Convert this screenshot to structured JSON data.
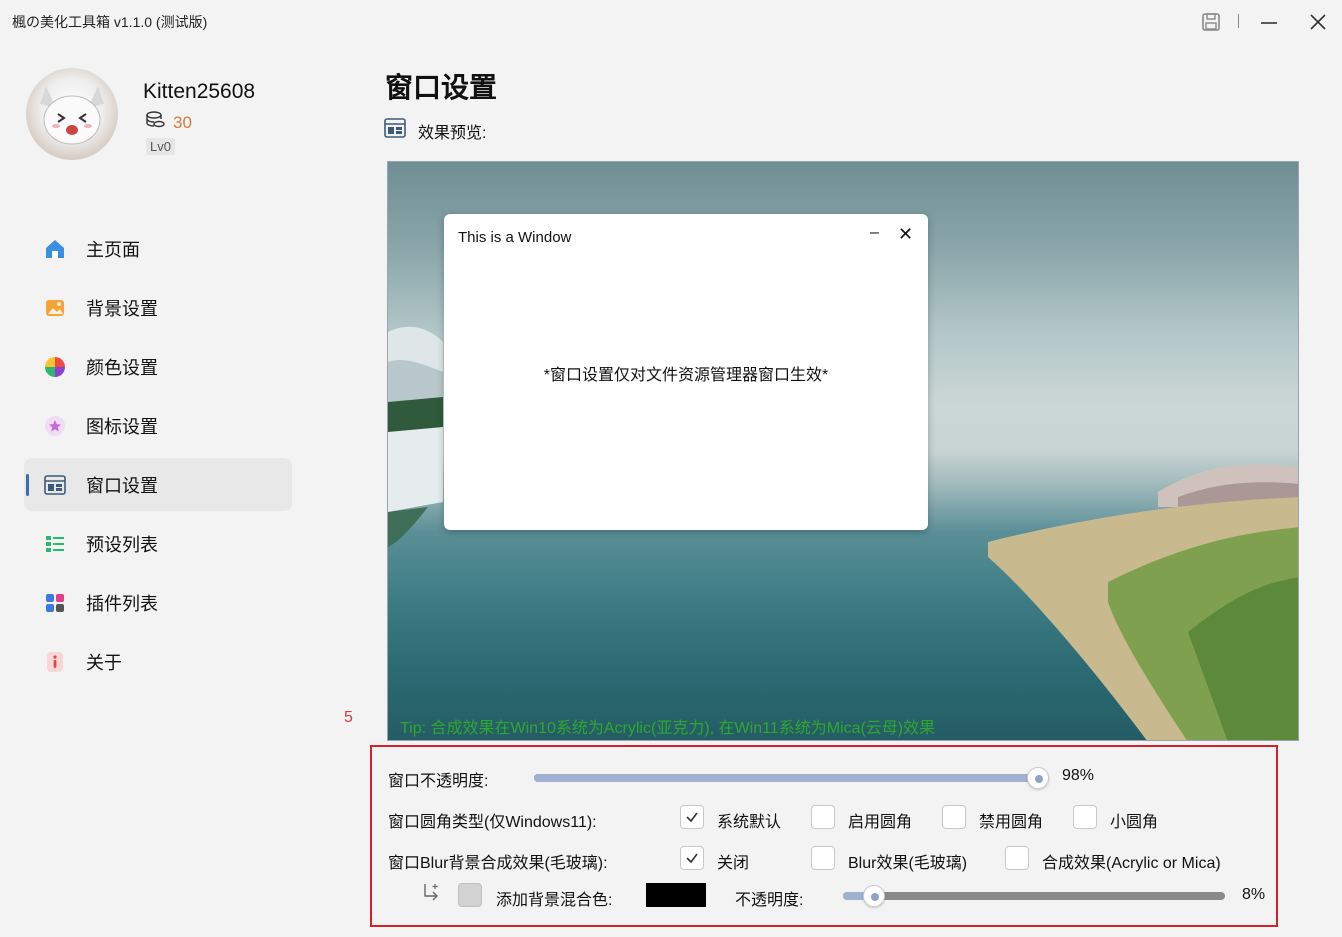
{
  "app": {
    "title": "楓の美化工具箱 v1.1.0 (测试版)"
  },
  "user": {
    "name": "Kitten25608",
    "coins": "30",
    "level": "Lv0"
  },
  "nav": {
    "items": [
      {
        "label": "主页面",
        "icon": "home-icon"
      },
      {
        "label": "背景设置",
        "icon": "image-icon"
      },
      {
        "label": "颜色设置",
        "icon": "color-wheel-icon"
      },
      {
        "label": "图标设置",
        "icon": "star-icon"
      },
      {
        "label": "窗口设置",
        "icon": "window-layout-icon",
        "active": true
      },
      {
        "label": "预设列表",
        "icon": "list-icon"
      },
      {
        "label": "插件列表",
        "icon": "plugin-grid-icon"
      },
      {
        "label": "关于",
        "icon": "info-icon"
      }
    ],
    "page_number": "5"
  },
  "main": {
    "title": "窗口设置",
    "preview_label": "效果预览:",
    "preview_window": {
      "title": "This is a Window",
      "note": "*窗口设置仅对文件资源管理器窗口生效*"
    },
    "tip": "Tip: 合成效果在Win10系统为Acrylic(亚克力), 在Win11系统为Mica(云母)效果"
  },
  "settings": {
    "opacity": {
      "label": "窗口不透明度:",
      "value": 98,
      "display": "98%"
    },
    "corner": {
      "label": "窗口圆角类型(仅Windows11):",
      "options": [
        {
          "label": "系统默认",
          "checked": true
        },
        {
          "label": "启用圆角",
          "checked": false
        },
        {
          "label": "禁用圆角",
          "checked": false
        },
        {
          "label": "小圆角",
          "checked": false
        }
      ]
    },
    "blur": {
      "label": "窗口Blur背景合成效果(毛玻璃):",
      "options": [
        {
          "label": "关闭",
          "checked": true
        },
        {
          "label": "Blur效果(毛玻璃)",
          "checked": false
        },
        {
          "label": "合成效果(Acrylic or Mica)",
          "checked": false
        }
      ]
    },
    "blend": {
      "label": "添加背景混合色:",
      "enabled": false,
      "color": "#000000",
      "opacity_label": "不透明度:",
      "opacity_value": 8,
      "opacity_display": "8%"
    }
  },
  "colors": {
    "accent": "#3c6db0",
    "tip": "#2fa72f",
    "highlight_border": "#d0222d",
    "coin": "#d77b3f"
  }
}
